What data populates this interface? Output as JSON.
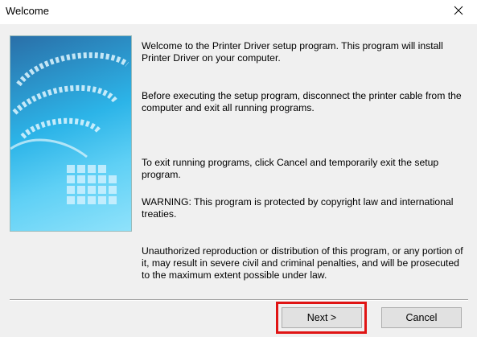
{
  "window": {
    "title": "Welcome"
  },
  "content": {
    "paragraph_intro": "Welcome to the Printer Driver setup program. This program will install Printer Driver on your computer.",
    "paragraph_before": "Before executing the setup program, disconnect the printer cable from the computer and exit all running programs.",
    "paragraph_exit": "To exit running programs, click Cancel and temporarily exit the setup program.",
    "paragraph_warning": "WARNING: This program is protected by copyright law and international treaties.",
    "paragraph_unauthorized": "Unauthorized reproduction or distribution of this program, or any portion of it, may result in severe civil and criminal penalties, and will be prosecuted to the maximum extent possible under law."
  },
  "buttons": {
    "next_label": "Next >",
    "cancel_label": "Cancel"
  },
  "icons": {
    "close": "close-icon"
  },
  "colors": {
    "highlight": "#e01414"
  }
}
